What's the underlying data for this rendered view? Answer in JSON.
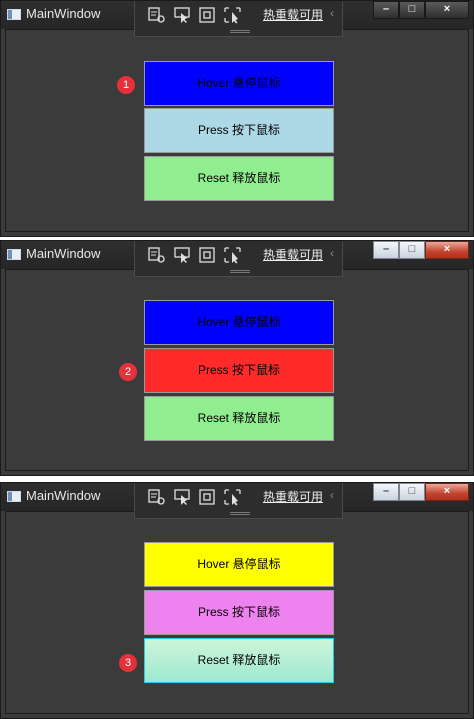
{
  "window": {
    "title": "MainWindow",
    "hot_reload_label": "热重载可用",
    "collapse_glyph": "‹",
    "caption_glyphs": {
      "minimize": "–",
      "maximize": "□",
      "close": "×"
    }
  },
  "buttons": {
    "hover_label": "Hover 悬停鼠标",
    "press_label": "Press 按下鼠标",
    "reset_label": "Reset 释放鼠标"
  },
  "panels": [
    {
      "badge": "1",
      "hover_color": "#0000FF",
      "press_color": "#ADD8E6",
      "reset_color": "#90EE90"
    },
    {
      "badge": "2",
      "hover_color": "#0000FF",
      "press_color": "#FF2A2A",
      "reset_color": "#90EE90"
    },
    {
      "badge": "3",
      "hover_color": "#FFFF00",
      "press_color": "#EE82EE",
      "reset_color": "#B5F0D0"
    }
  ],
  "icons": [
    "select-element-icon",
    "pointer-inspect-icon",
    "layout-adorner-icon",
    "track-focus-icon"
  ]
}
